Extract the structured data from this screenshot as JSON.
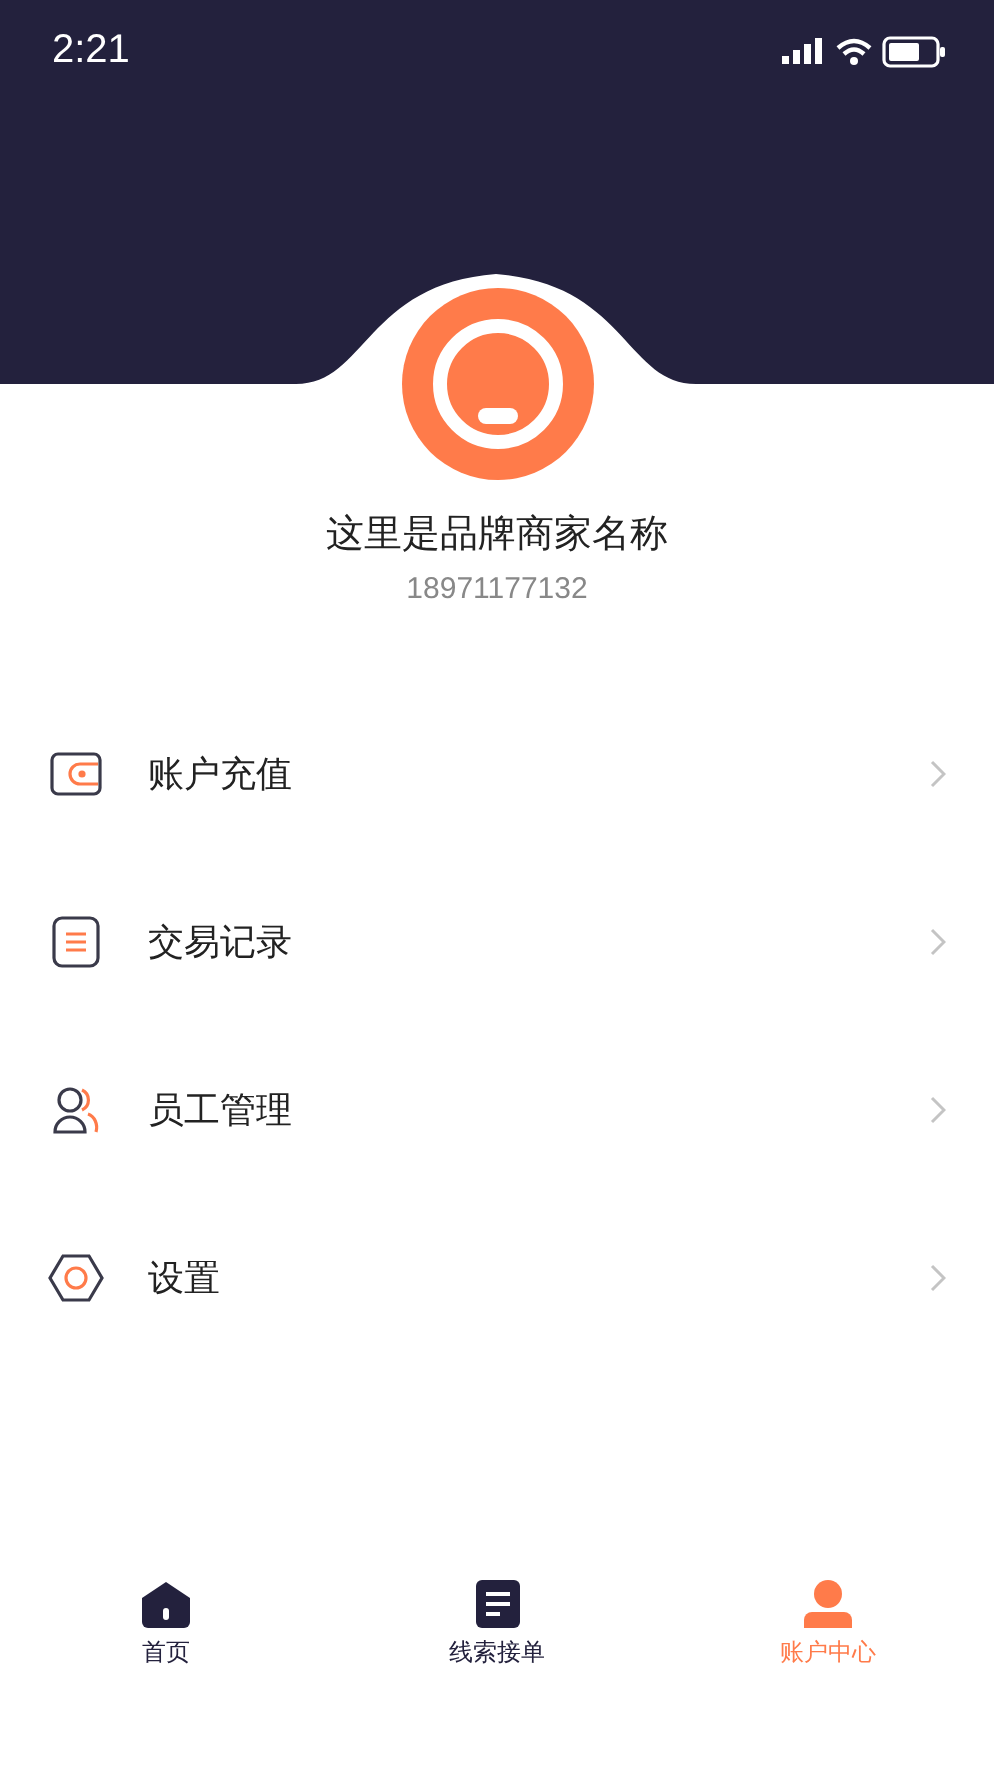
{
  "status_bar": {
    "time": "2:21"
  },
  "profile": {
    "name": "这里是品牌商家名称",
    "phone": "18971177132"
  },
  "menu": [
    {
      "kind": "wallet",
      "label": "账户充值"
    },
    {
      "kind": "list",
      "label": "交易记录"
    },
    {
      "kind": "people",
      "label": "员工管理"
    },
    {
      "kind": "settings",
      "label": "设置"
    }
  ],
  "tabs": [
    {
      "kind": "home",
      "label": "首页",
      "selected": false
    },
    {
      "kind": "doc",
      "label": "线索接单",
      "selected": false
    },
    {
      "kind": "user",
      "label": "账户中心",
      "selected": true
    }
  ]
}
